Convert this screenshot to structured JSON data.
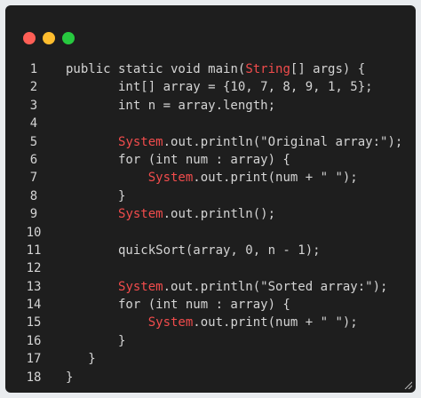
{
  "window": {
    "dot_colors": [
      "#ff5f56",
      "#ffbd2e",
      "#27c93f"
    ]
  },
  "code": {
    "lines": [
      {
        "n": "1",
        "segments": [
          {
            "t": "public static void ",
            "c": "k"
          },
          {
            "t": "main(",
            "c": "k"
          },
          {
            "t": "String",
            "c": "s"
          },
          {
            "t": "[] args) {",
            "c": "k"
          }
        ]
      },
      {
        "n": "2",
        "segments": [
          {
            "t": "       int[] array = {10, 7, 8, 9, 1, 5};",
            "c": "k"
          }
        ]
      },
      {
        "n": "3",
        "segments": [
          {
            "t": "       int n = array.length;",
            "c": "k"
          }
        ]
      },
      {
        "n": "4",
        "segments": []
      },
      {
        "n": "5",
        "segments": [
          {
            "t": "       ",
            "c": "k"
          },
          {
            "t": "System",
            "c": "s"
          },
          {
            "t": ".out.println(\"Original array:\");",
            "c": "k"
          }
        ]
      },
      {
        "n": "6",
        "segments": [
          {
            "t": "       for (int num : array) {",
            "c": "k"
          }
        ]
      },
      {
        "n": "7",
        "segments": [
          {
            "t": "           ",
            "c": "k"
          },
          {
            "t": "System",
            "c": "s"
          },
          {
            "t": ".out.print(num + \" \");",
            "c": "k"
          }
        ]
      },
      {
        "n": "8",
        "segments": [
          {
            "t": "       }",
            "c": "k"
          }
        ]
      },
      {
        "n": "9",
        "segments": [
          {
            "t": "       ",
            "c": "k"
          },
          {
            "t": "System",
            "c": "s"
          },
          {
            "t": ".out.println();",
            "c": "k"
          }
        ]
      },
      {
        "n": "10",
        "segments": []
      },
      {
        "n": "11",
        "segments": [
          {
            "t": "       quickSort(array, 0, n - 1);",
            "c": "k"
          }
        ]
      },
      {
        "n": "12",
        "segments": []
      },
      {
        "n": "13",
        "segments": [
          {
            "t": "       ",
            "c": "k"
          },
          {
            "t": "System",
            "c": "s"
          },
          {
            "t": ".out.println(\"Sorted array:\");",
            "c": "k"
          }
        ]
      },
      {
        "n": "14",
        "segments": [
          {
            "t": "       for (int num : array) {",
            "c": "k"
          }
        ]
      },
      {
        "n": "15",
        "segments": [
          {
            "t": "           ",
            "c": "k"
          },
          {
            "t": "System",
            "c": "s"
          },
          {
            "t": ".out.print(num + \" \");",
            "c": "k"
          }
        ]
      },
      {
        "n": "16",
        "segments": [
          {
            "t": "       }",
            "c": "k"
          }
        ]
      },
      {
        "n": "17",
        "segments": [
          {
            "t": "   }",
            "c": "k"
          }
        ]
      },
      {
        "n": "18",
        "segments": [
          {
            "t": "}",
            "c": "k"
          }
        ]
      }
    ]
  }
}
